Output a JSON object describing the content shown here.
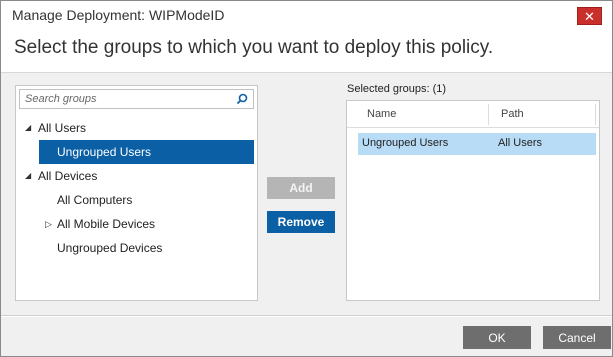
{
  "window": {
    "title": "Manage Deployment: WIPModeID",
    "close_glyph": "✕"
  },
  "heading": "Select the groups to which you want to deploy this policy.",
  "search": {
    "placeholder": "Search groups",
    "icon": "search-icon"
  },
  "tree": [
    {
      "label": "All Users",
      "arrow": "◢",
      "level": 0,
      "selected": false
    },
    {
      "label": "Ungrouped Users",
      "arrow": "",
      "level": 1,
      "selected": true
    },
    {
      "label": "All Devices",
      "arrow": "◢",
      "level": 0,
      "selected": false
    },
    {
      "label": "All Computers",
      "arrow": "",
      "level": 1,
      "selected": false
    },
    {
      "label": "All Mobile Devices",
      "arrow": "▷",
      "level": 1,
      "selected": false
    },
    {
      "label": "Ungrouped Devices",
      "arrow": "",
      "level": 1,
      "selected": false
    }
  ],
  "buttons": {
    "add": "Add",
    "remove": "Remove",
    "ok": "OK",
    "cancel": "Cancel"
  },
  "selected": {
    "label": "Selected groups: (1)",
    "columns": {
      "name": "Name",
      "path": "Path"
    },
    "rows": [
      {
        "name": "Ungrouped Users",
        "path": "All Users"
      }
    ]
  },
  "colors": {
    "accent": "#0b5fa5",
    "selected_row": "#b8dbf6",
    "close": "#c9302c"
  }
}
